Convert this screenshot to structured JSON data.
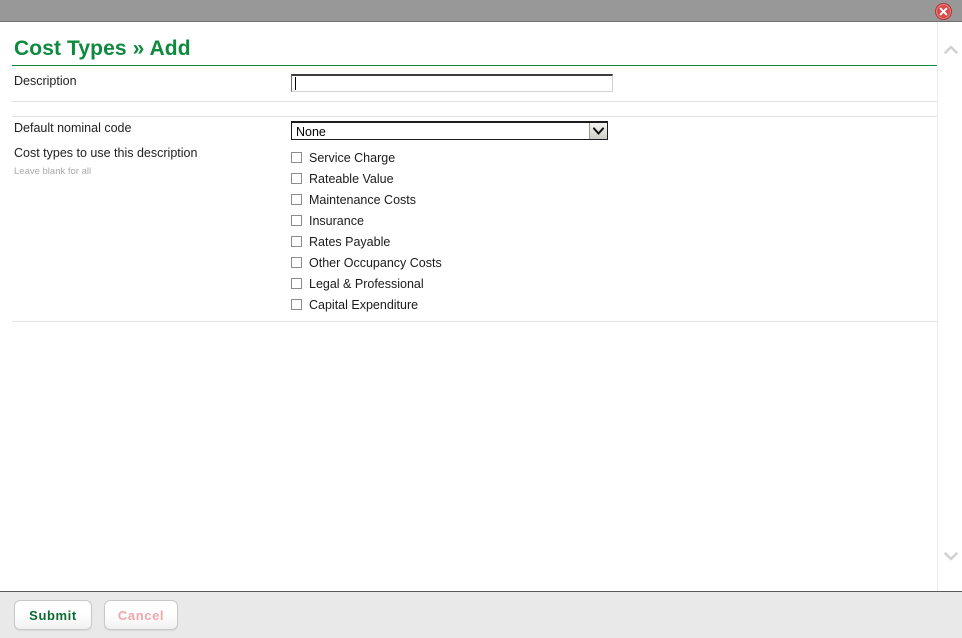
{
  "window": {
    "close_icon": "close-icon",
    "close_title": "Close"
  },
  "header": {
    "title": "Cost Types » Add"
  },
  "form": {
    "description": {
      "label": "Description",
      "value": "",
      "placeholder": ""
    },
    "nominal_code": {
      "label": "Default nominal code",
      "selected": "None",
      "options": [
        "None"
      ]
    },
    "cost_types": {
      "label": "Cost types to use this description",
      "hint": "Leave blank for all",
      "items": [
        {
          "label": "Service Charge",
          "checked": false
        },
        {
          "label": "Rateable Value",
          "checked": false
        },
        {
          "label": "Maintenance Costs",
          "checked": false
        },
        {
          "label": "Insurance",
          "checked": false
        },
        {
          "label": "Rates Payable",
          "checked": false
        },
        {
          "label": "Other Occupancy Costs",
          "checked": false
        },
        {
          "label": "Legal & Professional",
          "checked": false
        },
        {
          "label": "Capital Expenditure",
          "checked": false
        }
      ]
    }
  },
  "footer": {
    "submit_label": "Submit",
    "cancel_label": "Cancel"
  },
  "scrollbar": {
    "up_icon": "chevron-up-icon",
    "down_icon": "chevron-down-icon"
  },
  "colors": {
    "accent_green": "#0e8a3e",
    "submit_green": "#0c6b33",
    "cancel_pink": "#eda7ad",
    "titlebar_grey": "#989898",
    "footer_grey": "#e9e9e9",
    "close_red": "#d94a4a"
  }
}
